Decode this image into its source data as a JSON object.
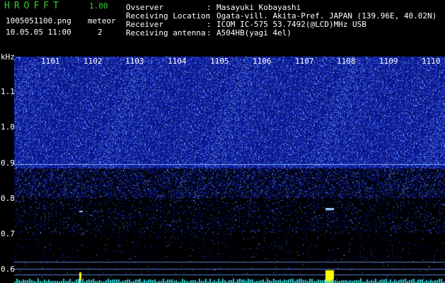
{
  "app": {
    "title": "HROFFT",
    "version": "1.00"
  },
  "file": {
    "name": "1005051100.png",
    "datetime": "10.05.05 11:00"
  },
  "meteor": {
    "label": "meteor",
    "count": "2"
  },
  "meta": [
    {
      "key": "Ovserver",
      "value": "Masayuki Kobayashi"
    },
    {
      "key": "Receiving Location",
      "value": "Ogata-vill. Akita-Pref. JAPAN (139.96E, 40.02N)"
    },
    {
      "key": "Receiver",
      "value": "ICOM IC-575 53.7492(@LCD)MHz USB"
    },
    {
      "key": "Receiving antenna",
      "value": "A504HB(yagi 4el)"
    }
  ],
  "axis": {
    "y_unit": "kHz",
    "y_ticks": [
      "1.1",
      "1.0",
      "0.9",
      "0.8",
      "0.7",
      "0.6"
    ],
    "x_ticks": [
      "1101",
      "1102",
      "1103",
      "1104",
      "1105",
      "1106",
      "1107",
      "1108",
      "1109",
      "1110"
    ]
  },
  "colors": {
    "title": "#2fd22f",
    "text": "#ffffff",
    "signal": "#ffff00"
  }
}
